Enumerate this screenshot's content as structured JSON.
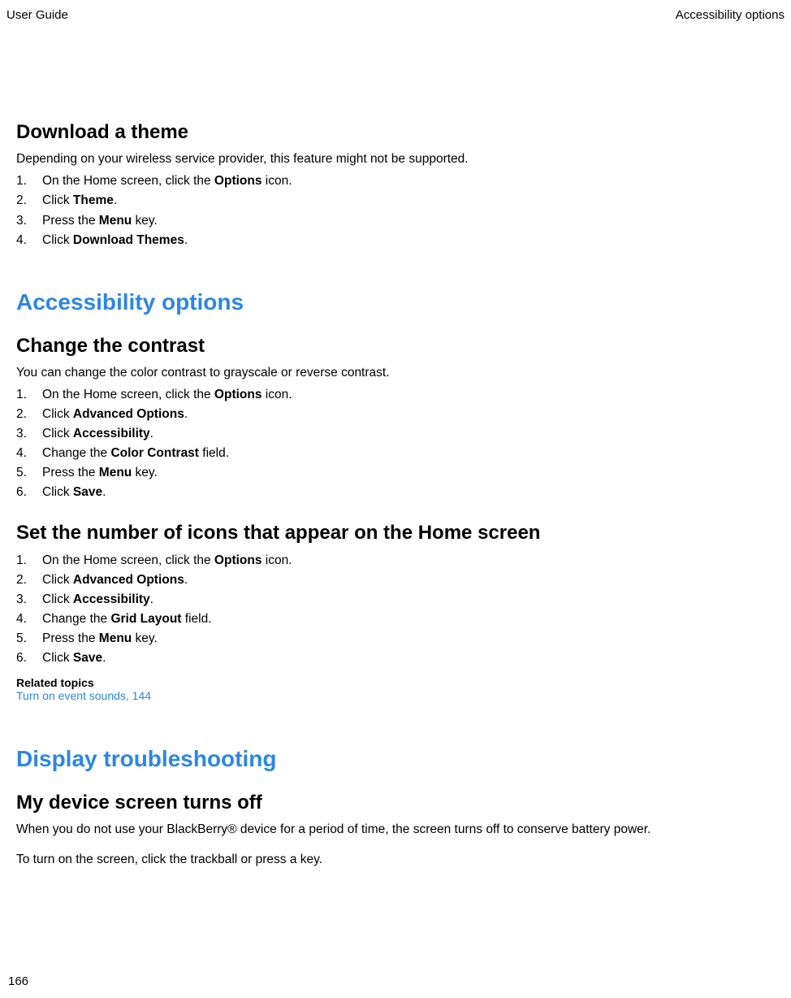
{
  "header": {
    "left": "User Guide",
    "right": "Accessibility options"
  },
  "section1": {
    "title": "Download a theme",
    "intro": "Depending on your wireless service provider, this feature might not be supported.",
    "steps": [
      {
        "prefix": "On the Home screen, click the ",
        "bold": "Options",
        "suffix": " icon."
      },
      {
        "prefix": "Click ",
        "bold": "Theme",
        "suffix": "."
      },
      {
        "prefix": "Press the ",
        "bold": "Menu",
        "suffix": " key."
      },
      {
        "prefix": "Click ",
        "bold": "Download Themes",
        "suffix": "."
      }
    ]
  },
  "section2": {
    "title": "Accessibility options"
  },
  "section3": {
    "title": "Change the contrast",
    "intro": "You can change the color contrast to grayscale or reverse contrast.",
    "steps": [
      {
        "prefix": "On the Home screen, click the ",
        "bold": "Options",
        "suffix": " icon."
      },
      {
        "prefix": "Click ",
        "bold": "Advanced Options",
        "suffix": "."
      },
      {
        "prefix": "Click ",
        "bold": "Accessibility",
        "suffix": "."
      },
      {
        "prefix": "Change the ",
        "bold": "Color Contrast",
        "suffix": " field."
      },
      {
        "prefix": "Press the ",
        "bold": "Menu",
        "suffix": " key."
      },
      {
        "prefix": "Click ",
        "bold": "Save",
        "suffix": "."
      }
    ]
  },
  "section4": {
    "title": "Set the number of icons that appear on the Home screen",
    "steps": [
      {
        "prefix": "On the Home screen, click the ",
        "bold": "Options",
        "suffix": " icon."
      },
      {
        "prefix": "Click ",
        "bold": "Advanced Options",
        "suffix": "."
      },
      {
        "prefix": "Click ",
        "bold": "Accessibility",
        "suffix": "."
      },
      {
        "prefix": "Change the ",
        "bold": "Grid Layout",
        "suffix": " field."
      },
      {
        "prefix": "Press the ",
        "bold": "Menu",
        "suffix": " key."
      },
      {
        "prefix": "Click ",
        "bold": "Save",
        "suffix": "."
      }
    ],
    "relatedHeading": "Related topics",
    "relatedLink": "Turn on event sounds, 144"
  },
  "section5": {
    "title": "Display troubleshooting"
  },
  "section6": {
    "title": "My device screen turns off",
    "para1": "When you do not use your BlackBerry® device for a period of time, the screen turns off to conserve battery power.",
    "para2": "To turn on the screen, click the trackball or press a key."
  },
  "pageNumber": "166"
}
